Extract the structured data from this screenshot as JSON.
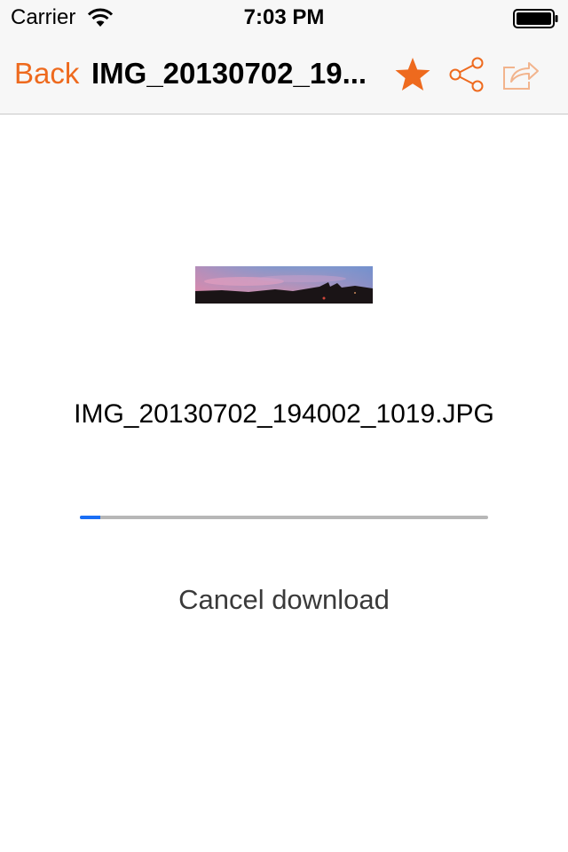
{
  "status_bar": {
    "carrier": "Carrier",
    "time": "7:03 PM",
    "icons": [
      "wifi-icon",
      "battery-icon"
    ]
  },
  "nav_bar": {
    "back_label": "Back",
    "title": "IMG_20130702_19...",
    "icons": [
      "star-icon",
      "share-icon",
      "export-icon"
    ],
    "accent_color": "#ee6a1e"
  },
  "content": {
    "thumbnail": "image-thumbnail",
    "filename": "IMG_20130702_194002_1019.JPG",
    "progress": 0.05,
    "progress_color": "#1a6ef5",
    "cancel_label": "Cancel download"
  }
}
